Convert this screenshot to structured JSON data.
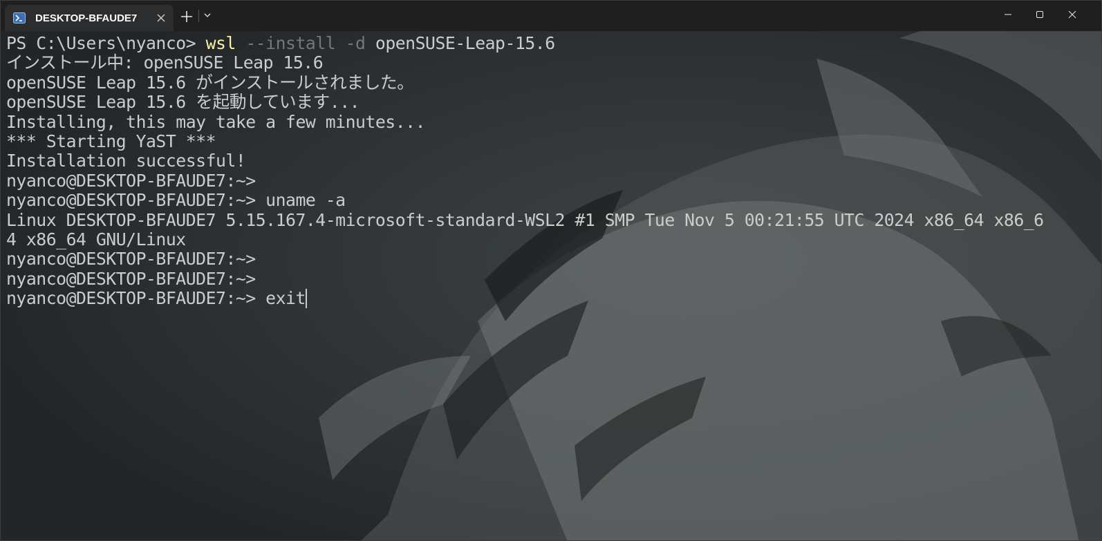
{
  "window": {
    "tab_title": "DESKTOP-BFAUDE7",
    "tab_icon": "powershell-icon",
    "new_tab_icon": "plus-icon",
    "dropdown_icon": "chevron-down-icon",
    "minimize_icon": "minimize-icon",
    "maximize_icon": "maximize-icon",
    "close_icon": "close-icon"
  },
  "colors": {
    "background": "#232628",
    "text": "#cccccc",
    "command": "#f9f1a5",
    "parameter": "#767676"
  },
  "terminal": {
    "ps_prompt": "PS C:\\Users\\nyanco> ",
    "ps_command": "wsl",
    "ps_params": " --install -d",
    "ps_arg": " openSUSE-Leap-15.6",
    "lines": [
      "インストール中: openSUSE Leap 15.6",
      "openSUSE Leap 15.6 がインストールされました。",
      "openSUSE Leap 15.6 を起動しています...",
      "Installing, this may take a few minutes...",
      "*** Starting YaST ***",
      "Installation successful!",
      "nyanco@DESKTOP-BFAUDE7:~>",
      "nyanco@DESKTOP-BFAUDE7:~> uname -a",
      "Linux DESKTOP-BFAUDE7 5.15.167.4-microsoft-standard-WSL2 #1 SMP Tue Nov 5 00:21:55 UTC 2024 x86_64 x86_6",
      "4 x86_64 GNU/Linux",
      "nyanco@DESKTOP-BFAUDE7:~>",
      "nyanco@DESKTOP-BFAUDE7:~>"
    ],
    "current_prompt": "nyanco@DESKTOP-BFAUDE7:~> ",
    "current_input": "exit"
  }
}
